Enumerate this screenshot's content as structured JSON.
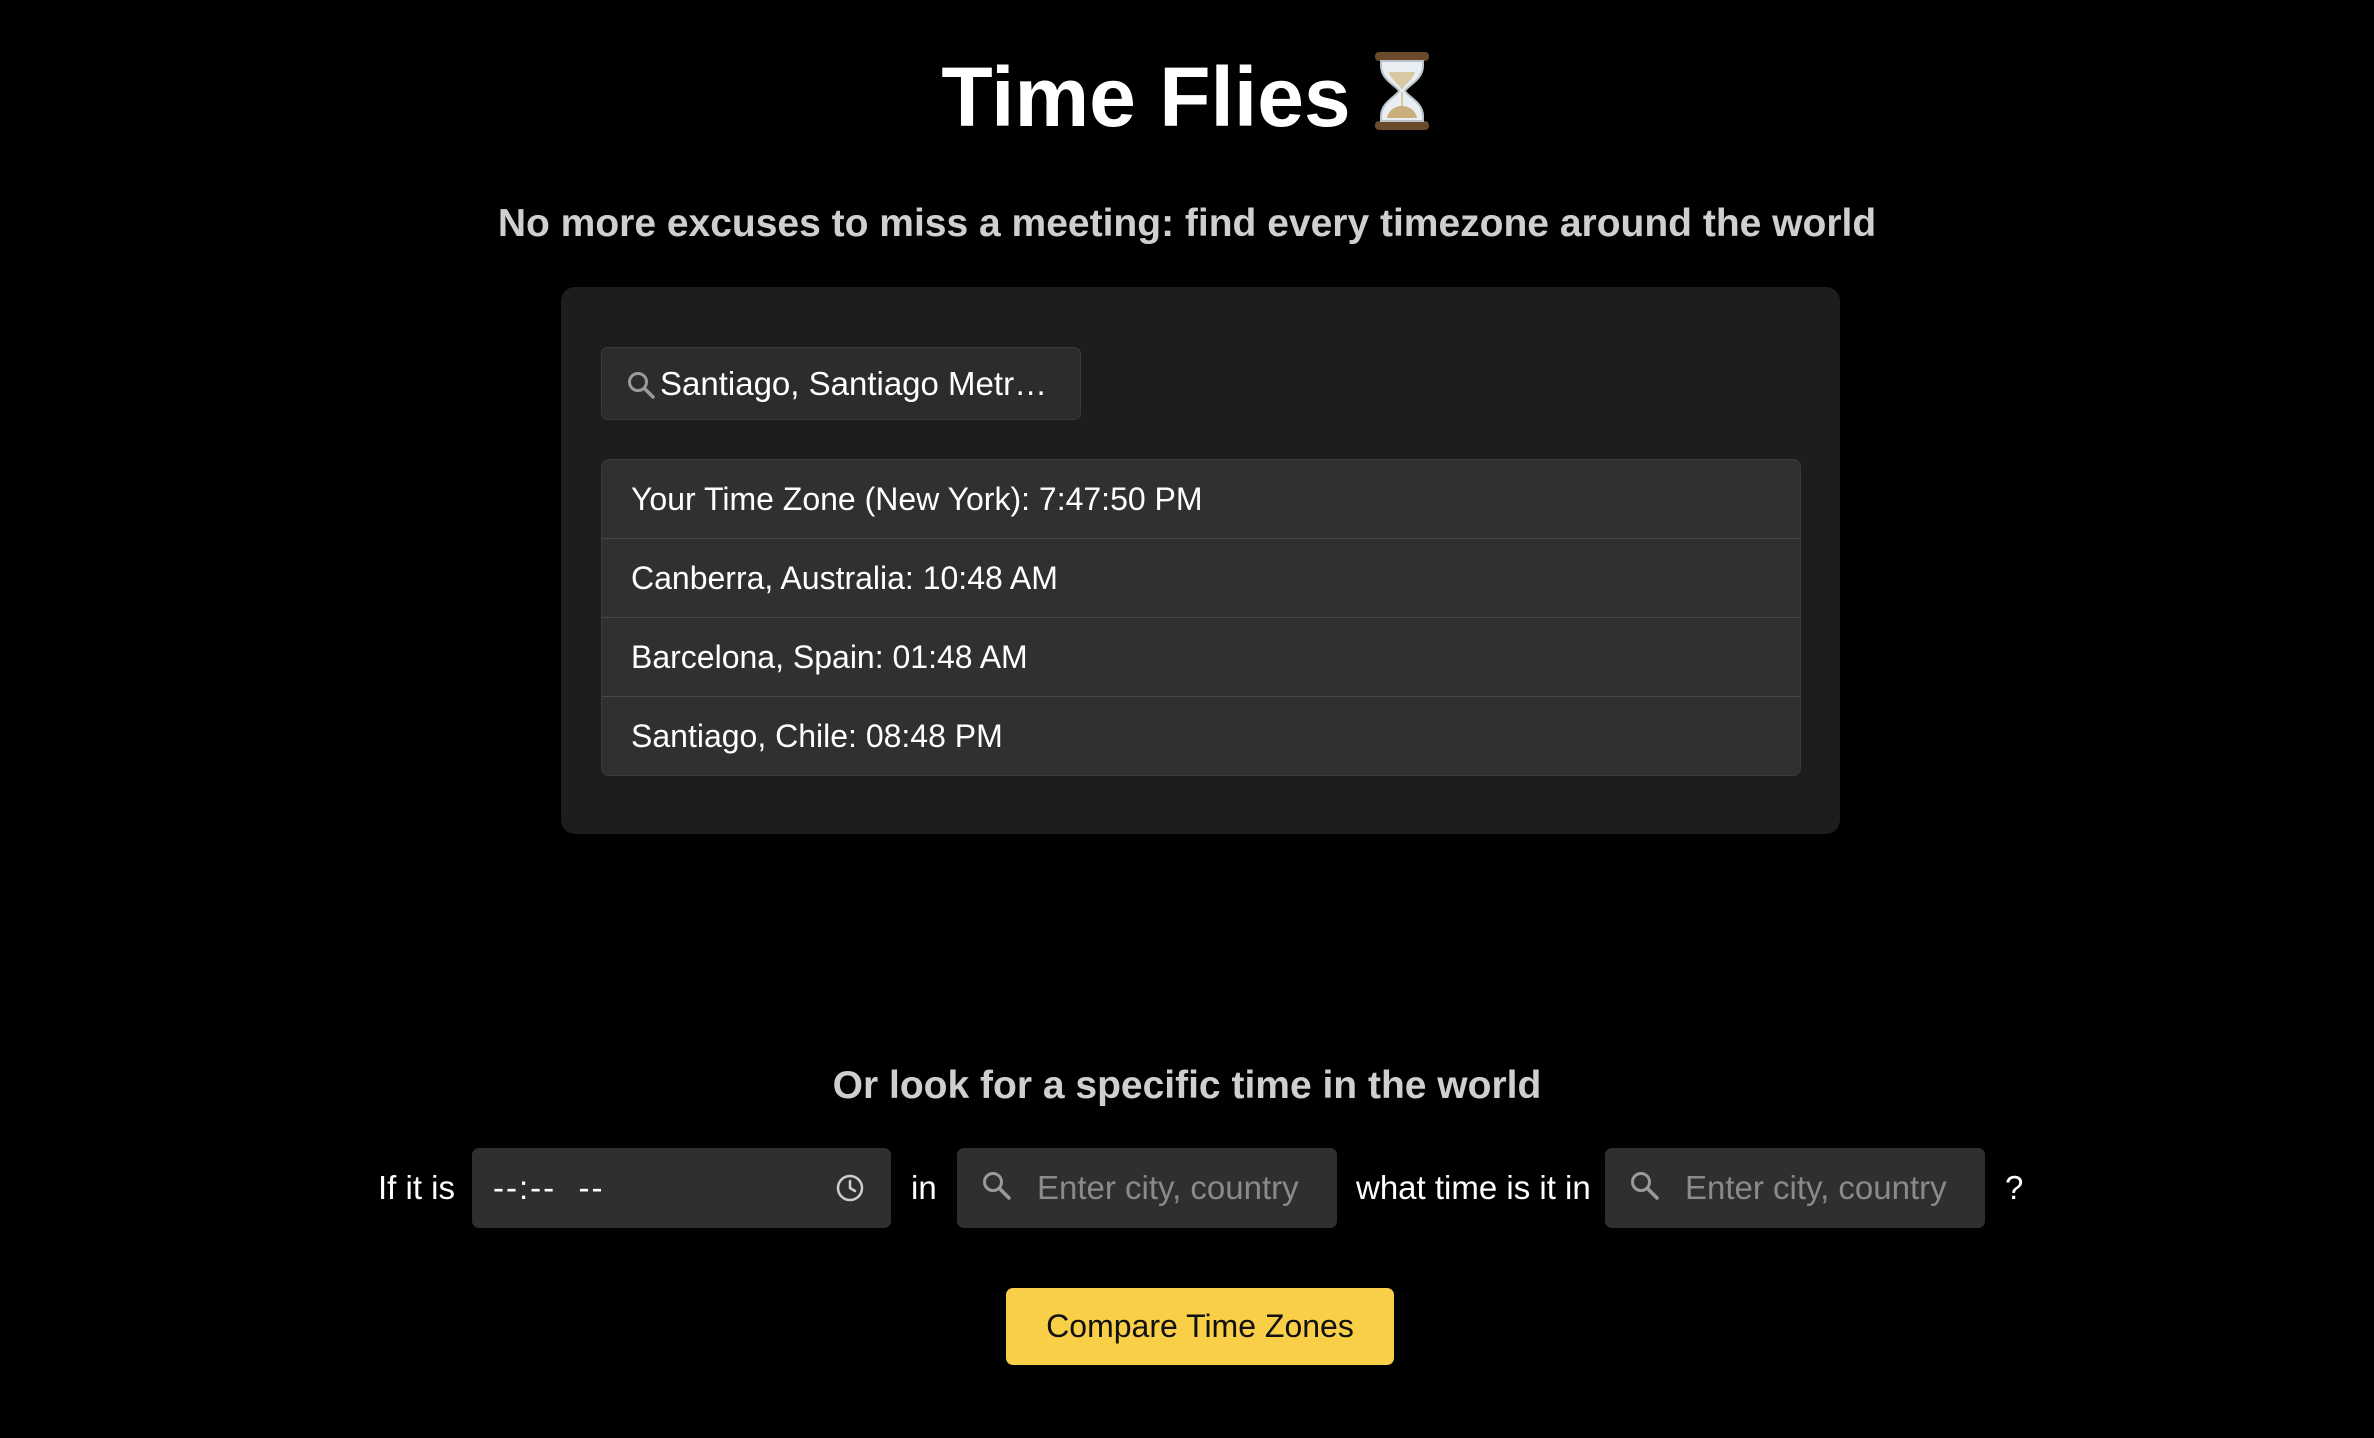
{
  "header": {
    "title": "Time Flies",
    "title_icon": "hourglass-icon",
    "subtitle": "No more excuses to miss a meeting: find every timezone around the world"
  },
  "search": {
    "icon": "search-icon",
    "value": "Santiago, Santiago Metropolitan Region, Chile"
  },
  "timezones": [
    {
      "label": "Your Time Zone (New York): 7:47:50 PM"
    },
    {
      "label": "Canberra, Australia: 10:48 AM"
    },
    {
      "label": "Barcelona, Spain: 01:48 AM"
    },
    {
      "label": "Santiago, Chile: 08:48 PM"
    }
  ],
  "converter": {
    "heading": "Or look for a specific time in the world",
    "prefix": "If it is",
    "time_placeholder": "--:--  --",
    "time_icon": "clock-icon",
    "in_label": "in",
    "from_placeholder": "Enter city, country",
    "middle_label": "what time is it in",
    "to_placeholder": "Enter city, country",
    "suffix": "?",
    "button_label": "Compare Time Zones"
  },
  "colors": {
    "background": "#000000",
    "card": "#1d1d1d",
    "list": "#303030",
    "input": "#2f2f2f",
    "accent": "#f8cf47",
    "muted_heading": "#cfcfcf"
  }
}
